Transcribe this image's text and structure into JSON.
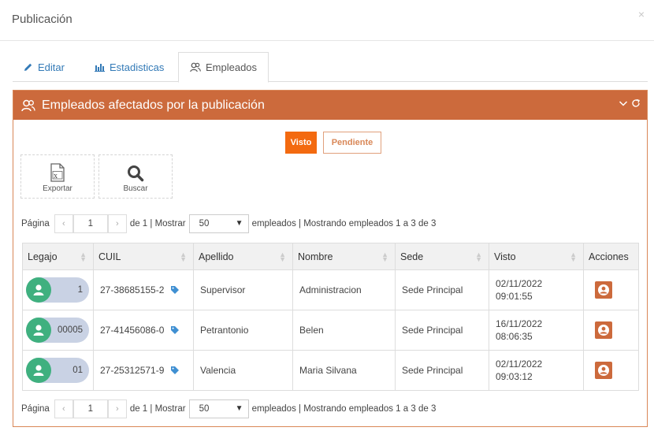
{
  "modal": {
    "title": "Publicación",
    "close": "×"
  },
  "tabs": [
    {
      "label": "Editar",
      "icon": "pencil-icon"
    },
    {
      "label": "Estadisticas",
      "icon": "bar-chart-icon"
    },
    {
      "label": "Empleados",
      "icon": "users-icon",
      "active": true
    }
  ],
  "portlet": {
    "title": "Empleados afectados por la publicación",
    "accent_color": "#cc6a3c"
  },
  "status": {
    "visto": "Visto",
    "pendiente": "Pendiente",
    "selected": "Visto"
  },
  "actions": {
    "exportar": "Exportar",
    "buscar": "Buscar"
  },
  "pager": {
    "pagina_label": "Página",
    "page": "1",
    "of_label": "de 1 | Mostrar",
    "per_page": "50",
    "summary": "empleados | Mostrando empleados 1 a 3 de 3"
  },
  "table": {
    "headers": [
      "Legajo",
      "CUIL",
      "Apellido",
      "Nombre",
      "Sede",
      "Visto",
      "Acciones"
    ],
    "rows": [
      {
        "legajo": "1",
        "cuil": "27-38685155-2",
        "apellido": "Supervisor",
        "nombre": "Administracion",
        "sede": "Sede Principal",
        "visto_date": "02/11/2022",
        "visto_time": "09:01:55"
      },
      {
        "legajo": "00005",
        "cuil": "27-41456086-0",
        "apellido": "Petrantonio",
        "nombre": "Belen",
        "sede": "Sede Principal",
        "visto_date": "16/11/2022",
        "visto_time": "08:06:35"
      },
      {
        "legajo": "01",
        "cuil": "27-25312571-9",
        "apellido": "Valencia",
        "nombre": "Maria Silvana",
        "sede": "Sede Principal",
        "visto_date": "02/11/2022",
        "visto_time": "09:03:12"
      }
    ]
  }
}
